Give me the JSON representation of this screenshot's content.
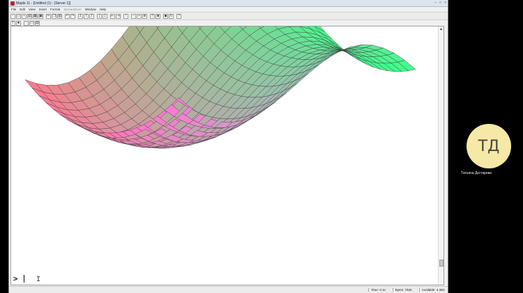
{
  "window": {
    "title": "Maple 11 - [Untitled (1) - [Server 1]]",
    "controls": [
      "–",
      "□",
      "×"
    ]
  },
  "menu": {
    "items": [
      {
        "label": "File",
        "dim": false
      },
      {
        "label": "Edit",
        "dim": false
      },
      {
        "label": "View",
        "dim": false
      },
      {
        "label": "Insert",
        "dim": false
      },
      {
        "label": "Format",
        "dim": false
      },
      {
        "label": "Spreadsheet",
        "dim": true
      },
      {
        "label": "Window",
        "dim": false
      },
      {
        "label": "Help",
        "dim": false
      }
    ]
  },
  "document": {
    "prompt": ">",
    "plot_description": "3D colored surface plot"
  },
  "status": {
    "time": "Time: 0.1s",
    "bytes": "Bytes: 782K",
    "available": "Available: 4.38G"
  },
  "meeting": {
    "avatar_initials": "ТД",
    "user_name": "Татьяна Дегтярева",
    "avatar_color": "#f6e8a6"
  }
}
